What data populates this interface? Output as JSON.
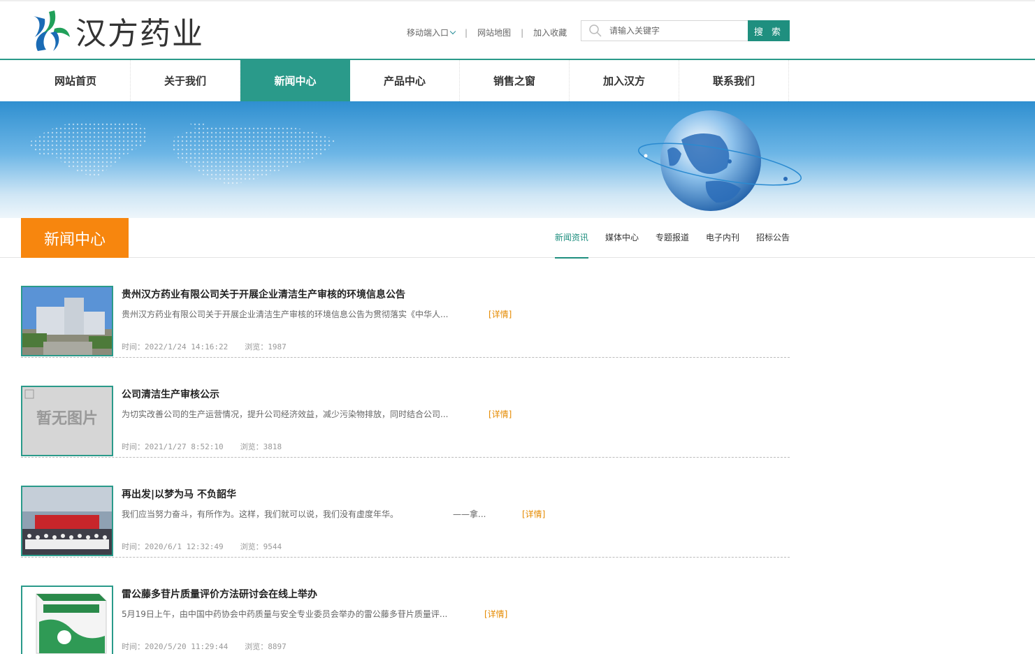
{
  "header": {
    "logo_text": "汉方药业",
    "links": [
      "移动端入口",
      "网站地图",
      "加入收藏"
    ],
    "search_placeholder": "请输入关键字",
    "search_button": "搜 索"
  },
  "nav": {
    "items": [
      "网站首页",
      "关于我们",
      "新闻中心",
      "产品中心",
      "销售之窗",
      "加入汉方",
      "联系我们"
    ],
    "active_index": 2
  },
  "section": {
    "title": "新闻中心",
    "subnav": [
      "新闻资讯",
      "媒体中心",
      "专题报道",
      "电子内刊",
      "招标公告"
    ],
    "active_sub_index": 0
  },
  "news": [
    {
      "title": "贵州汉方药业有限公司关于开展企业清洁生产审核的环境信息公告",
      "summary": "贵州汉方药业有限公司关于开展企业清洁生产审核的环境信息公告为贯彻落实《中华人...",
      "more": "[详情]",
      "time": "时间：2022/1/24 14:16:22",
      "views": "浏览：1987",
      "thumb": "building"
    },
    {
      "title": "公司清洁生产审核公示",
      "summary": "为切实改善公司的生产运营情况，提升公司经济效益，减少污染物排放，同时结合公司...",
      "more": "[详情]",
      "time": "时间：2021/1/27 8:52:10",
      "views": "浏览：3818",
      "thumb": "placeholder",
      "thumb_text": "暂无图片"
    },
    {
      "title": "再出发|以梦为马 不负韶华",
      "summary": "我们应当努力奋斗，有所作为。这样，我们就可以说，我们没有虚度年华。　　　　　　　——拿...",
      "more": "[详情]",
      "time": "时间：2020/6/1 12:32:49",
      "views": "浏览：9544",
      "thumb": "group"
    },
    {
      "title": "雷公藤多苷片质量评价方法研讨会在线上举办",
      "summary": "5月19日上午，由中国中药协会中药质量与安全专业委员会举办的雷公藤多苷片质量评...",
      "more": "[详情]",
      "time": "时间：2020/5/20 11:29:44",
      "views": "浏览：8897",
      "thumb": "box"
    }
  ],
  "colors": {
    "primary_green": "#2a9a8a",
    "accent_orange": "#f7860e",
    "detail_orange": "#e58a00"
  }
}
